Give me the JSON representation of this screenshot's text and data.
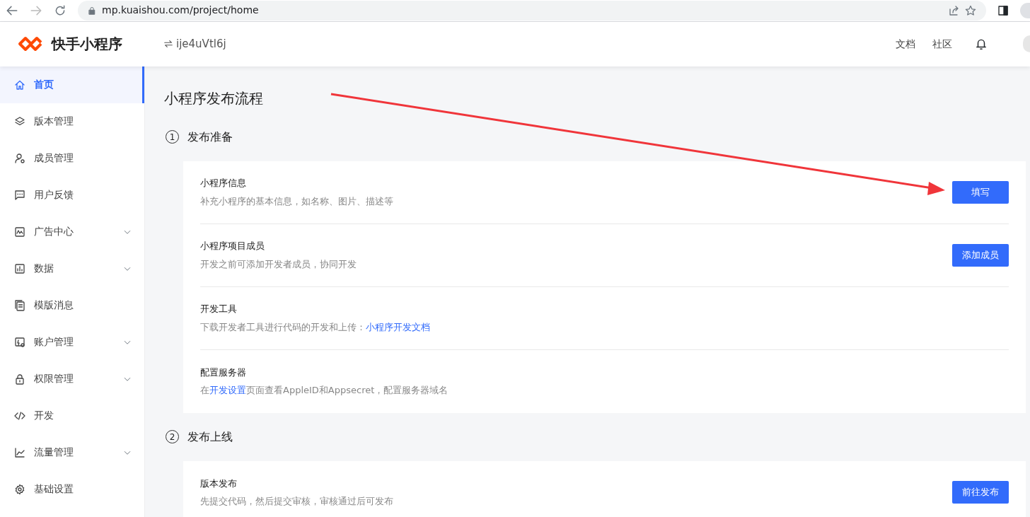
{
  "browser": {
    "url": "mp.kuaishou.com/project/home",
    "forward_disabled": true
  },
  "header": {
    "logo_text": "快手小程序",
    "app_id": "ije4uVtl6j",
    "links": [
      "文档",
      "社区"
    ]
  },
  "sidebar": {
    "items": [
      {
        "label": "首页",
        "selected": true,
        "has_caret": false
      },
      {
        "label": "版本管理",
        "selected": false,
        "has_caret": false
      },
      {
        "label": "成员管理",
        "selected": false,
        "has_caret": false
      },
      {
        "label": "用户反馈",
        "selected": false,
        "has_caret": false
      },
      {
        "label": "广告中心",
        "selected": false,
        "has_caret": true
      },
      {
        "label": "数据",
        "selected": false,
        "has_caret": true
      },
      {
        "label": "模版消息",
        "selected": false,
        "has_caret": false
      },
      {
        "label": "账户管理",
        "selected": false,
        "has_caret": true
      },
      {
        "label": "权限管理",
        "selected": false,
        "has_caret": true
      },
      {
        "label": "开发",
        "selected": false,
        "has_caret": false
      },
      {
        "label": "流量管理",
        "selected": false,
        "has_caret": true
      },
      {
        "label": "基础设置",
        "selected": false,
        "has_caret": false
      }
    ]
  },
  "page_title": "小程序发布流程",
  "sections": [
    {
      "number": "1",
      "title": "发布准备",
      "items": [
        {
          "title": "小程序信息",
          "desc": [
            {
              "text": "补充小程序的基本信息，如名称、图片、描述等"
            }
          ],
          "button": "填写"
        },
        {
          "title": "小程序项目成员",
          "desc": [
            {
              "text": "开发之前可添加开发者成员，协同开发"
            }
          ],
          "button": "添加成员"
        },
        {
          "title": "开发工具",
          "desc": [
            {
              "text": "下载开发者工具进行代码的开发和上传："
            },
            {
              "link": "小程序开发文档"
            }
          ]
        },
        {
          "title": "配置服务器",
          "desc": [
            {
              "text": "在"
            },
            {
              "link": "开发设置"
            },
            {
              "text": "页面查看AppleID和Appsecret，配置服务器域名"
            }
          ]
        }
      ]
    },
    {
      "number": "2",
      "title": "发布上线",
      "items": [
        {
          "title": "版本发布",
          "desc": [
            {
              "text": "先提交代码，然后提交审核，审核通过后可发布"
            }
          ],
          "button": "前往发布"
        }
      ]
    }
  ]
}
